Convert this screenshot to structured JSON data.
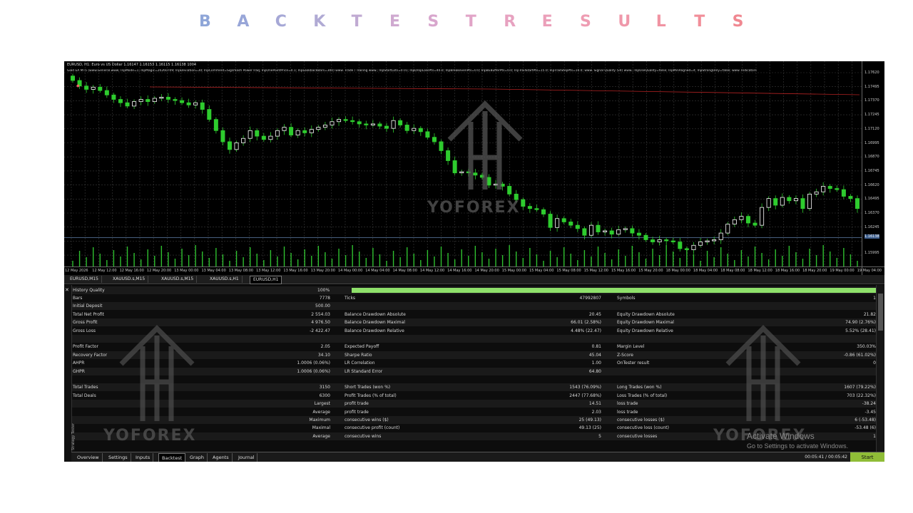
{
  "title_letters": [
    "B",
    "A",
    "C",
    "K",
    "T",
    "E",
    "S",
    "T",
    "R",
    "E",
    "S",
    "U",
    "L",
    "T",
    "S"
  ],
  "title_colors": [
    "#8fa6d8",
    "#98a6d8",
    "#a6a8d6",
    "#b0aad4",
    "#c0aad2",
    "#cfa9d0",
    "#d8a6cd",
    "#e1a4c7",
    "#e7a2c0",
    "#eb9fb9",
    "#ee9cb2",
    "#ef98aa",
    "#f093a2",
    "#f18e99",
    "#f08891"
  ],
  "chart": {
    "header": "EURUSD, H1:  Euro vs US Dollar  1.16147 1.16153 1.16115 1.16138  1004",
    "subheader": "Gold EA MT5 (www.General.www; InpMode=1; InpMagic=20260709; InpDeviation=30; InpComment=Sigsmash Power Iraq; InpOnePointPrice=0.1; InpLookbackBars=300) www. Trade / Trailing www.; InpStartLots=0.01; InpDropLossPts=40.0; InpBreakevenPts=0.0; InpBEBufferPts=0.0; InpTrailStartPts=15.0; InpTrailStepPts=10.0; www. Signal Quality (v4) www.; InpUseQuality=false; InpMinAligned=4; InpStrongOnly=false; www. Indicators",
    "price_labels": [
      "1.17620",
      "1.17495",
      "1.17370",
      "1.17245",
      "1.17120",
      "1.16995",
      "1.16870",
      "1.16745",
      "1.16620",
      "1.16495",
      "1.16370",
      "1.16245",
      "1.16138",
      "1.15995"
    ],
    "time_labels": [
      "12 May 2026",
      "12 May 12:00",
      "12 May 16:00",
      "12 May 20:00",
      "13 May 00:00",
      "13 May 04:00",
      "13 May 08:00",
      "13 May 12:00",
      "13 May 16:00",
      "13 May 20:00",
      "14 May 00:00",
      "14 May 04:00",
      "14 May 08:00",
      "14 May 12:00",
      "14 May 16:00",
      "14 May 20:00",
      "15 May 00:00",
      "15 May 04:00",
      "15 May 08:00",
      "15 May 12:00",
      "15 May 16:00",
      "15 May 20:00",
      "18 May 00:00",
      "18 May 04:00",
      "18 May 08:00",
      "18 May 12:00",
      "18 May 16:00",
      "18 May 20:00",
      "19 May 00:00",
      "19 May 04:00"
    ],
    "closes": [
      1.1755,
      1.175,
      1.1747,
      1.1749,
      1.1746,
      1.1742,
      1.1738,
      1.1735,
      1.1732,
      1.1736,
      1.1738,
      1.1736,
      1.1739,
      1.174,
      1.1738,
      1.1737,
      1.1735,
      1.1733,
      1.1735,
      1.1729,
      1.172,
      1.171,
      1.17,
      1.1693,
      1.1699,
      1.1703,
      1.171,
      1.1705,
      1.1702,
      1.1705,
      1.171,
      1.1713,
      1.1706,
      1.171,
      1.1708,
      1.1711,
      1.1713,
      1.1715,
      1.1718,
      1.172,
      1.1719,
      1.1718,
      1.1716,
      1.1715,
      1.1716,
      1.1714,
      1.1712,
      1.1719,
      1.1715,
      1.171,
      1.1712,
      1.1709,
      1.1704,
      1.17,
      1.1692,
      1.1683,
      1.1672,
      1.1673,
      1.1672,
      1.167,
      1.1668,
      1.1661,
      1.1662,
      1.166,
      1.1653,
      1.1648,
      1.1642,
      1.164,
      1.1639,
      1.1635,
      1.1623,
      1.1631,
      1.1628,
      1.1625,
      1.1622,
      1.1616,
      1.1625,
      1.1619,
      1.162,
      1.1617,
      1.1621,
      1.1622,
      1.1618,
      1.1616,
      1.1612,
      1.161,
      1.1612,
      1.1611,
      1.161,
      1.1604,
      1.1603,
      1.1607,
      1.161,
      1.1611,
      1.1612,
      1.1618,
      1.1626,
      1.163,
      1.1633,
      1.1627,
      1.1625,
      1.1641,
      1.1649,
      1.1643,
      1.165,
      1.1647,
      1.1649,
      1.164,
      1.1653,
      1.1655,
      1.166,
      1.1658,
      1.1657,
      1.1651,
      1.1649,
      1.164
    ]
  },
  "symbol_tabs": [
    "EURUSD,M15",
    "XAUUSD.s,M15",
    "XAUUSD.s,M15",
    "XAUUSD.s,H1",
    "EURUSD,H1"
  ],
  "active_symbol_tab": 4,
  "report": {
    "history_quality_label": "History Quality",
    "history_quality_value": "100%",
    "rows": [
      {
        "c1": "Bars",
        "v1": "7778",
        "c2": "Ticks",
        "v2": "47992807",
        "c3": "Symbols",
        "v3": "1"
      },
      {
        "c1": "Initial Deposit",
        "v1": "500.00",
        "c2": "",
        "v2": "",
        "c3": "",
        "v3": ""
      },
      {
        "c1": "Total Net Profit",
        "v1": "2 554.03",
        "c2": "Balance Drawdown Absolute",
        "v2": "20.45",
        "c3": "Equity Drawdown Absolute",
        "v3": "21.82"
      },
      {
        "c1": "Gross Profit",
        "v1": "4 976.50",
        "c2": "Balance Drawdown Maximal",
        "v2": "66.01 (2.58%)",
        "c3": "Equity Drawdown Maximal",
        "v3": "74.90 (2.76%)"
      },
      {
        "c1": "Gross Loss",
        "v1": "-2 422.47",
        "c2": "Balance Drawdown Relative",
        "v2": "4.48% (22.47)",
        "c3": "Equity Drawdown Relative",
        "v3": "5.52% (28.41)"
      },
      {
        "c1": "",
        "v1": "",
        "c2": "",
        "v2": "",
        "c3": "",
        "v3": ""
      },
      {
        "c1": "Profit Factor",
        "v1": "2.05",
        "c2": "Expected Payoff",
        "v2": "0.81",
        "c3": "Margin Level",
        "v3": "350.03%"
      },
      {
        "c1": "Recovery Factor",
        "v1": "34.10",
        "c2": "Sharpe Ratio",
        "v2": "45.04",
        "c3": "Z-Score",
        "v3": "-0.86 (61.02%)"
      },
      {
        "c1": "AHPR",
        "v1": "1.0006 (0.06%)",
        "c2": "LR Correlation",
        "v2": "1.00",
        "c3": "OnTester result",
        "v3": "0"
      },
      {
        "c1": "GHPR",
        "v1": "1.0006 (0.06%)",
        "c2": "LR Standard Error",
        "v2": "64.80",
        "c3": "",
        "v3": ""
      },
      {
        "c1": "",
        "v1": "",
        "c2": "",
        "v2": "",
        "c3": "",
        "v3": ""
      },
      {
        "c1": "Total Trades",
        "v1": "3150",
        "c2": "Short Trades (won %)",
        "v2": "1543 (76.09%)",
        "c3": "Long Trades (won %)",
        "v3": "1607 (79.22%)"
      },
      {
        "c1": "Total Deals",
        "v1": "6300",
        "c2": "Profit Trades (% of total)",
        "v2": "2447 (77.68%)",
        "c3": "Loss Trades (% of total)",
        "v3": "703 (22.32%)"
      },
      {
        "c1": "",
        "v1": "Largest",
        "c2": "profit trade",
        "v2": "14.51",
        "c3": "loss trade",
        "v3": "-38.24"
      },
      {
        "c1": "",
        "v1": "Average",
        "c2": "profit trade",
        "v2": "2.03",
        "c3": "loss trade",
        "v3": "-3.45"
      },
      {
        "c1": "",
        "v1": "Maximum",
        "c2": "consecutive wins ($)",
        "v2": "25 (49.13)",
        "c3": "consecutive losses ($)",
        "v3": "6 (-53.48)"
      },
      {
        "c1": "",
        "v1": "Maximal",
        "c2": "consecutive profit (count)",
        "v2": "49.13 (25)",
        "c3": "consecutive loss (count)",
        "v3": "-53.48 (6)"
      },
      {
        "c1": "",
        "v1": "Average",
        "c2": "consecutive wins",
        "v2": "5",
        "c3": "consecutive losses",
        "v3": "1"
      }
    ]
  },
  "side_label": "Strategy Tester",
  "bottom_tabs": [
    "Overview",
    "Settings",
    "Inputs",
    "Backtest",
    "Graph",
    "Agents",
    "Journal"
  ],
  "active_bottom_tab": 3,
  "timer": "00:05:41 / 00:05:42",
  "start_label": "Start",
  "watermark_text": "YOFOREX",
  "activate": {
    "line1": "Activate Windows",
    "line2": "Go to Settings to activate Windows."
  },
  "colors": {
    "bull": "#ffffff",
    "bear": "#2ecc2e",
    "volume": "#2fbf2f",
    "grid": "#3a3a3a",
    "ma_line": "#b22222",
    "hq_bar": "#8ee06a",
    "start": "#8fbd37"
  }
}
